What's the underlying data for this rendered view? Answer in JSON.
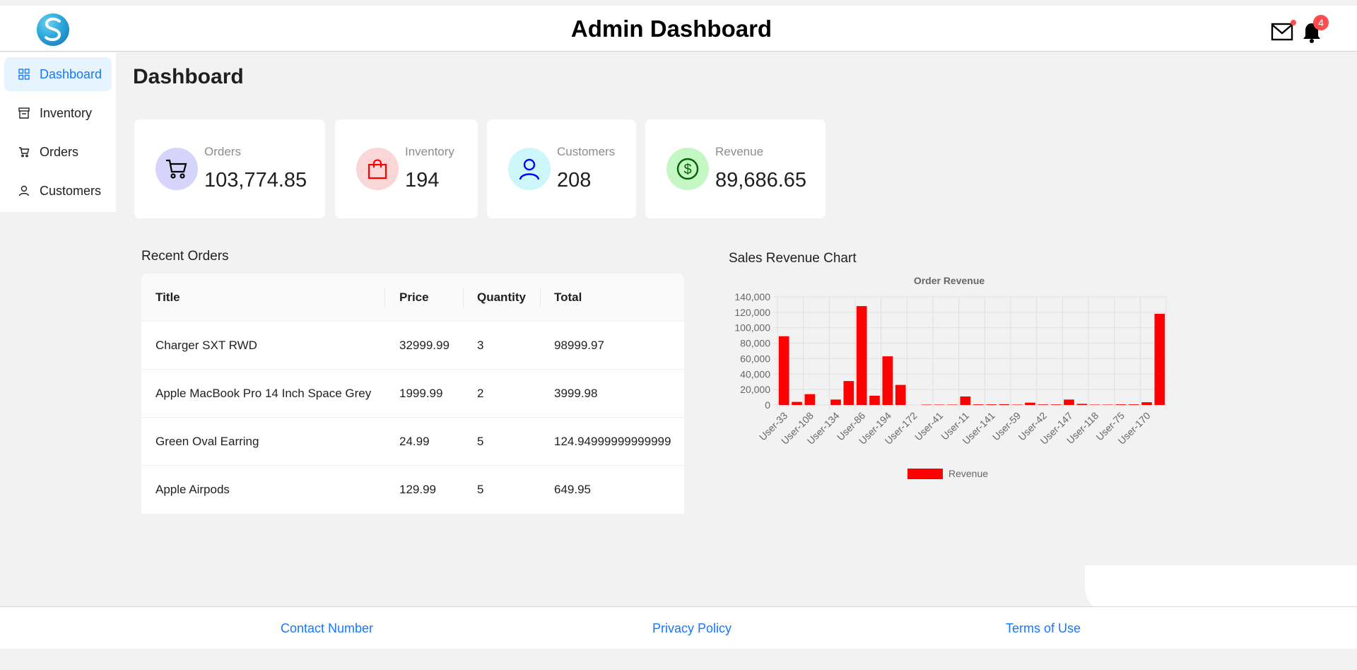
{
  "header": {
    "title": "Admin Dashboard",
    "notification_count": "4"
  },
  "sidebar": {
    "items": [
      {
        "label": "Dashboard"
      },
      {
        "label": "Inventory"
      },
      {
        "label": "Orders"
      },
      {
        "label": "Customers"
      }
    ]
  },
  "main": {
    "page_title": "Dashboard"
  },
  "stats": [
    {
      "label": "Orders",
      "value": "103,774.85",
      "color": "#d6d4fb"
    },
    {
      "label": "Inventory",
      "value": "194",
      "color": "#fbd6d6"
    },
    {
      "label": "Customers",
      "value": "208",
      "color": "#cdf6fb"
    },
    {
      "label": "Revenue",
      "value": "89,686.65",
      "color": "#c5f7c5"
    }
  ],
  "recent_orders": {
    "title": "Recent Orders",
    "columns": [
      "Title",
      "Price",
      "Quantity",
      "Total"
    ],
    "rows": [
      [
        "Charger SXT RWD",
        "32999.99",
        "3",
        "98999.97"
      ],
      [
        "Apple MacBook Pro 14 Inch Space Grey",
        "1999.99",
        "2",
        "3999.98"
      ],
      [
        "Green Oval Earring",
        "24.99",
        "5",
        "124.94999999999999"
      ],
      [
        "Apple Airpods",
        "129.99",
        "5",
        "649.95"
      ]
    ]
  },
  "chart_section": {
    "title": "Sales Revenue Chart"
  },
  "chart_data": {
    "type": "bar",
    "title": "Order Revenue",
    "xlabel": "",
    "ylabel": "",
    "ylim": [
      0,
      140000
    ],
    "yticks": [
      "140,000",
      "120,000",
      "100,000",
      "80,000",
      "60,000",
      "40,000",
      "20,000",
      "0"
    ],
    "tick_labels": [
      "User-33",
      "User-108",
      "User-134",
      "User-86",
      "User-194",
      "User-172",
      "User-41",
      "User-11",
      "User-141",
      "User-59",
      "User-42",
      "User-147",
      "User-118",
      "User-75",
      "User-170"
    ],
    "values": [
      89000,
      4000,
      14000,
      0,
      7000,
      31000,
      128000,
      12000,
      63000,
      26000,
      0,
      500,
      500,
      500,
      11000,
      800,
      800,
      1000,
      500,
      3000,
      700,
      700,
      7000,
      1500,
      500,
      500,
      800,
      800,
      3500,
      118000
    ],
    "series": [
      {
        "name": "Revenue",
        "color": "#ff0000"
      }
    ],
    "legend": "bottom",
    "grid": true
  },
  "footer": {
    "links": [
      "Contact Number",
      "Privacy Policy",
      "Terms of Use"
    ]
  }
}
